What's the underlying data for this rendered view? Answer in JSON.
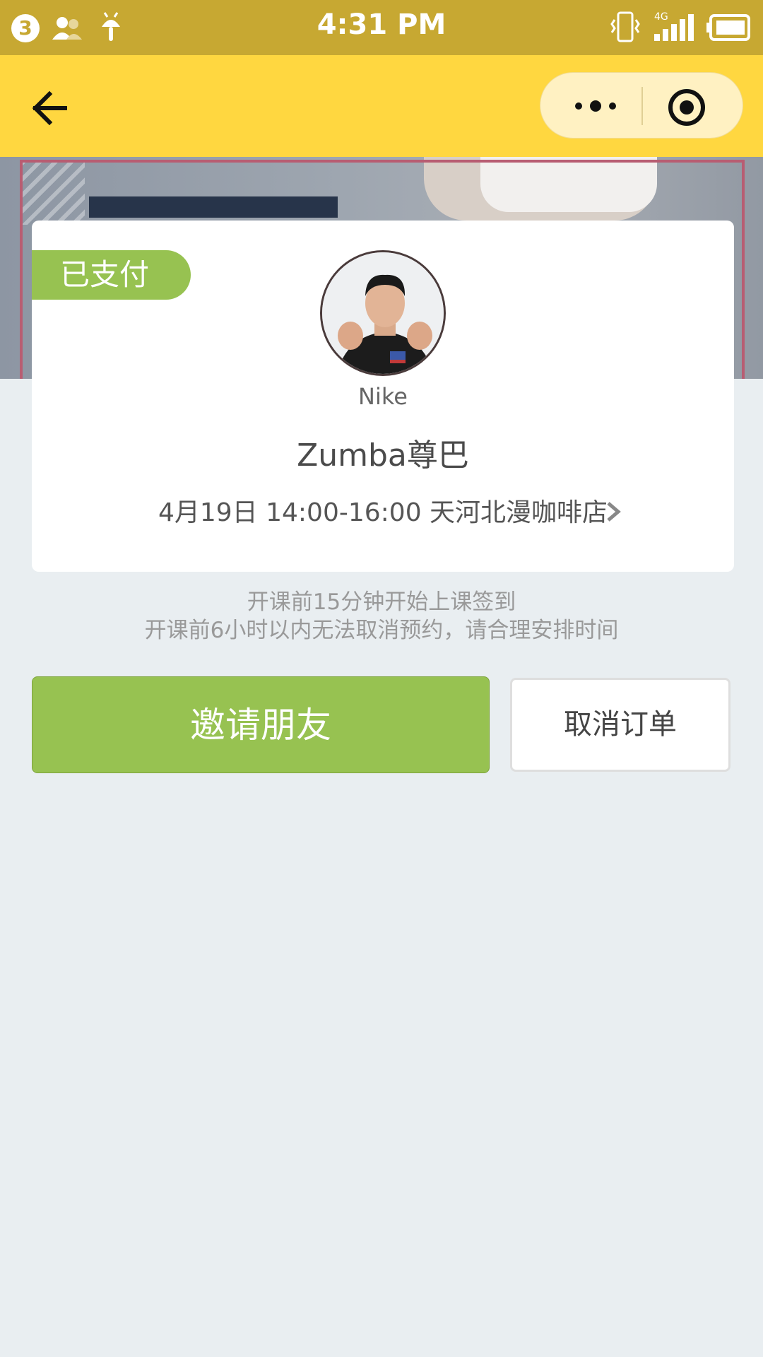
{
  "status_bar": {
    "notification_count": "3",
    "time": "4:31 PM",
    "network": "4G"
  },
  "app_bar": {
    "back_icon": "arrow-left-icon",
    "more_icon": "more-dots-icon",
    "close_icon": "target-circle-icon"
  },
  "card": {
    "status_badge": "已支付",
    "coach_name": "Nike",
    "course_title": "Zumba尊巴",
    "course_info": "4月19日 14:00-16:00 天河北漫咖啡店"
  },
  "notes": {
    "line1": "开课前15分钟开始上课签到",
    "line2": "开课前6小时以内无法取消预约，请合理安排时间"
  },
  "actions": {
    "invite_label": "邀请朋友",
    "cancel_label": "取消订单"
  },
  "colors": {
    "status_bar": "#c7a832",
    "app_bar": "#ffd740",
    "accent_green": "#97c251",
    "background": "#e9eef1"
  }
}
